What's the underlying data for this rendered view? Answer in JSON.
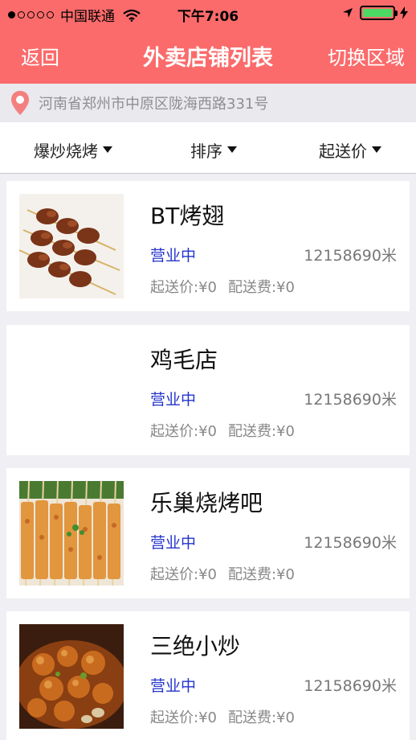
{
  "status_bar": {
    "carrier": "中国联通",
    "time": "下午7:06",
    "signal_filled": 1,
    "signal_total": 5,
    "battery_level": 1.0
  },
  "nav": {
    "back_label": "返回",
    "title": "外卖店铺列表",
    "switch_label": "切换区域"
  },
  "address": {
    "text": "河南省郑州市中原区陇海西路331号",
    "icon": "location-pin-icon"
  },
  "filters": [
    {
      "label": "爆炒烧烤"
    },
    {
      "label": "排序"
    },
    {
      "label": "起送价"
    }
  ],
  "shops": [
    {
      "name": "BT烤翅",
      "status": "营业中",
      "distance": "12158690米",
      "min_order": "起送价:¥0",
      "delivery_fee": "配送费:¥0",
      "image": "meat-skewers"
    },
    {
      "name": "鸡毛店",
      "status": "营业中",
      "distance": "12158690米",
      "min_order": "起送价:¥0",
      "delivery_fee": "配送费:¥0",
      "image": "none"
    },
    {
      "name": "乐巢烧烤吧",
      "status": "营业中",
      "distance": "12158690米",
      "min_order": "起送价:¥0",
      "delivery_fee": "配送费:¥0",
      "image": "tofu-skewers"
    },
    {
      "name": "三绝小炒",
      "status": "营业中",
      "distance": "12158690米",
      "min_order": "起送价:¥0",
      "delivery_fee": "配送费:¥0",
      "image": "stir-fry"
    }
  ],
  "colors": {
    "header": "#fb6b6b",
    "status_open": "#2233cc",
    "background": "#efeff4"
  }
}
